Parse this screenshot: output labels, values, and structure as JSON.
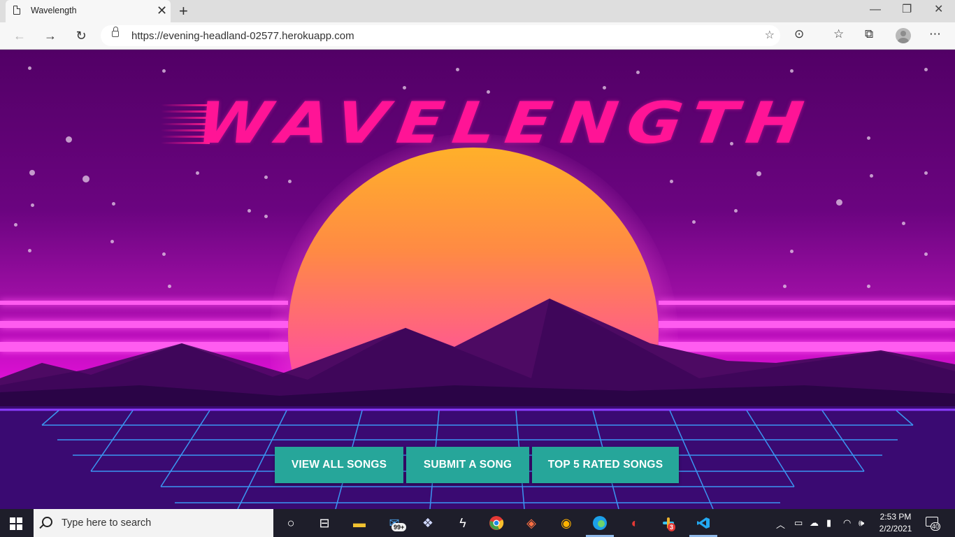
{
  "browser": {
    "tab_title": "Wavelength",
    "tab_close": "✕",
    "new_tab": "+",
    "url": "https://evening-headland-02577.herokuapp.com",
    "window_controls": {
      "minimize": "—",
      "restore": "❐",
      "close": "✕"
    },
    "nav": {
      "back": "←",
      "forward": "→",
      "refresh": "↻"
    },
    "toolbar_icons": [
      "add-favorite-icon",
      "reader-icon",
      "favorites-icon",
      "collections-icon",
      "profile-icon",
      "more-icon"
    ]
  },
  "hero": {
    "title": "Wavelength",
    "colors": {
      "title": "#ff1496",
      "sun_top": "#ffb02a",
      "sun_bottom": "#ff36c4",
      "grid": "#3aa6ff",
      "button": "#26a69a"
    }
  },
  "actions": {
    "view_all": "VIEW ALL SONGS",
    "submit": "SUBMIT A SONG",
    "top5": "TOP 5 RATED SONGS"
  },
  "taskbar": {
    "search_placeholder": "Type here to search",
    "mail_badge": "99+",
    "slack_badge": "3",
    "time": "2:53 PM",
    "date": "2/2/2021",
    "notifications_count": "40",
    "apps": [
      "task-view-icon",
      "file-explorer-icon",
      "mail-icon",
      "dropbox-icon",
      "app-icon",
      "chrome-icon",
      "git-icon",
      "app-icon",
      "edge-icon",
      "app-icon",
      "slack-icon",
      "vscode-icon"
    ]
  }
}
